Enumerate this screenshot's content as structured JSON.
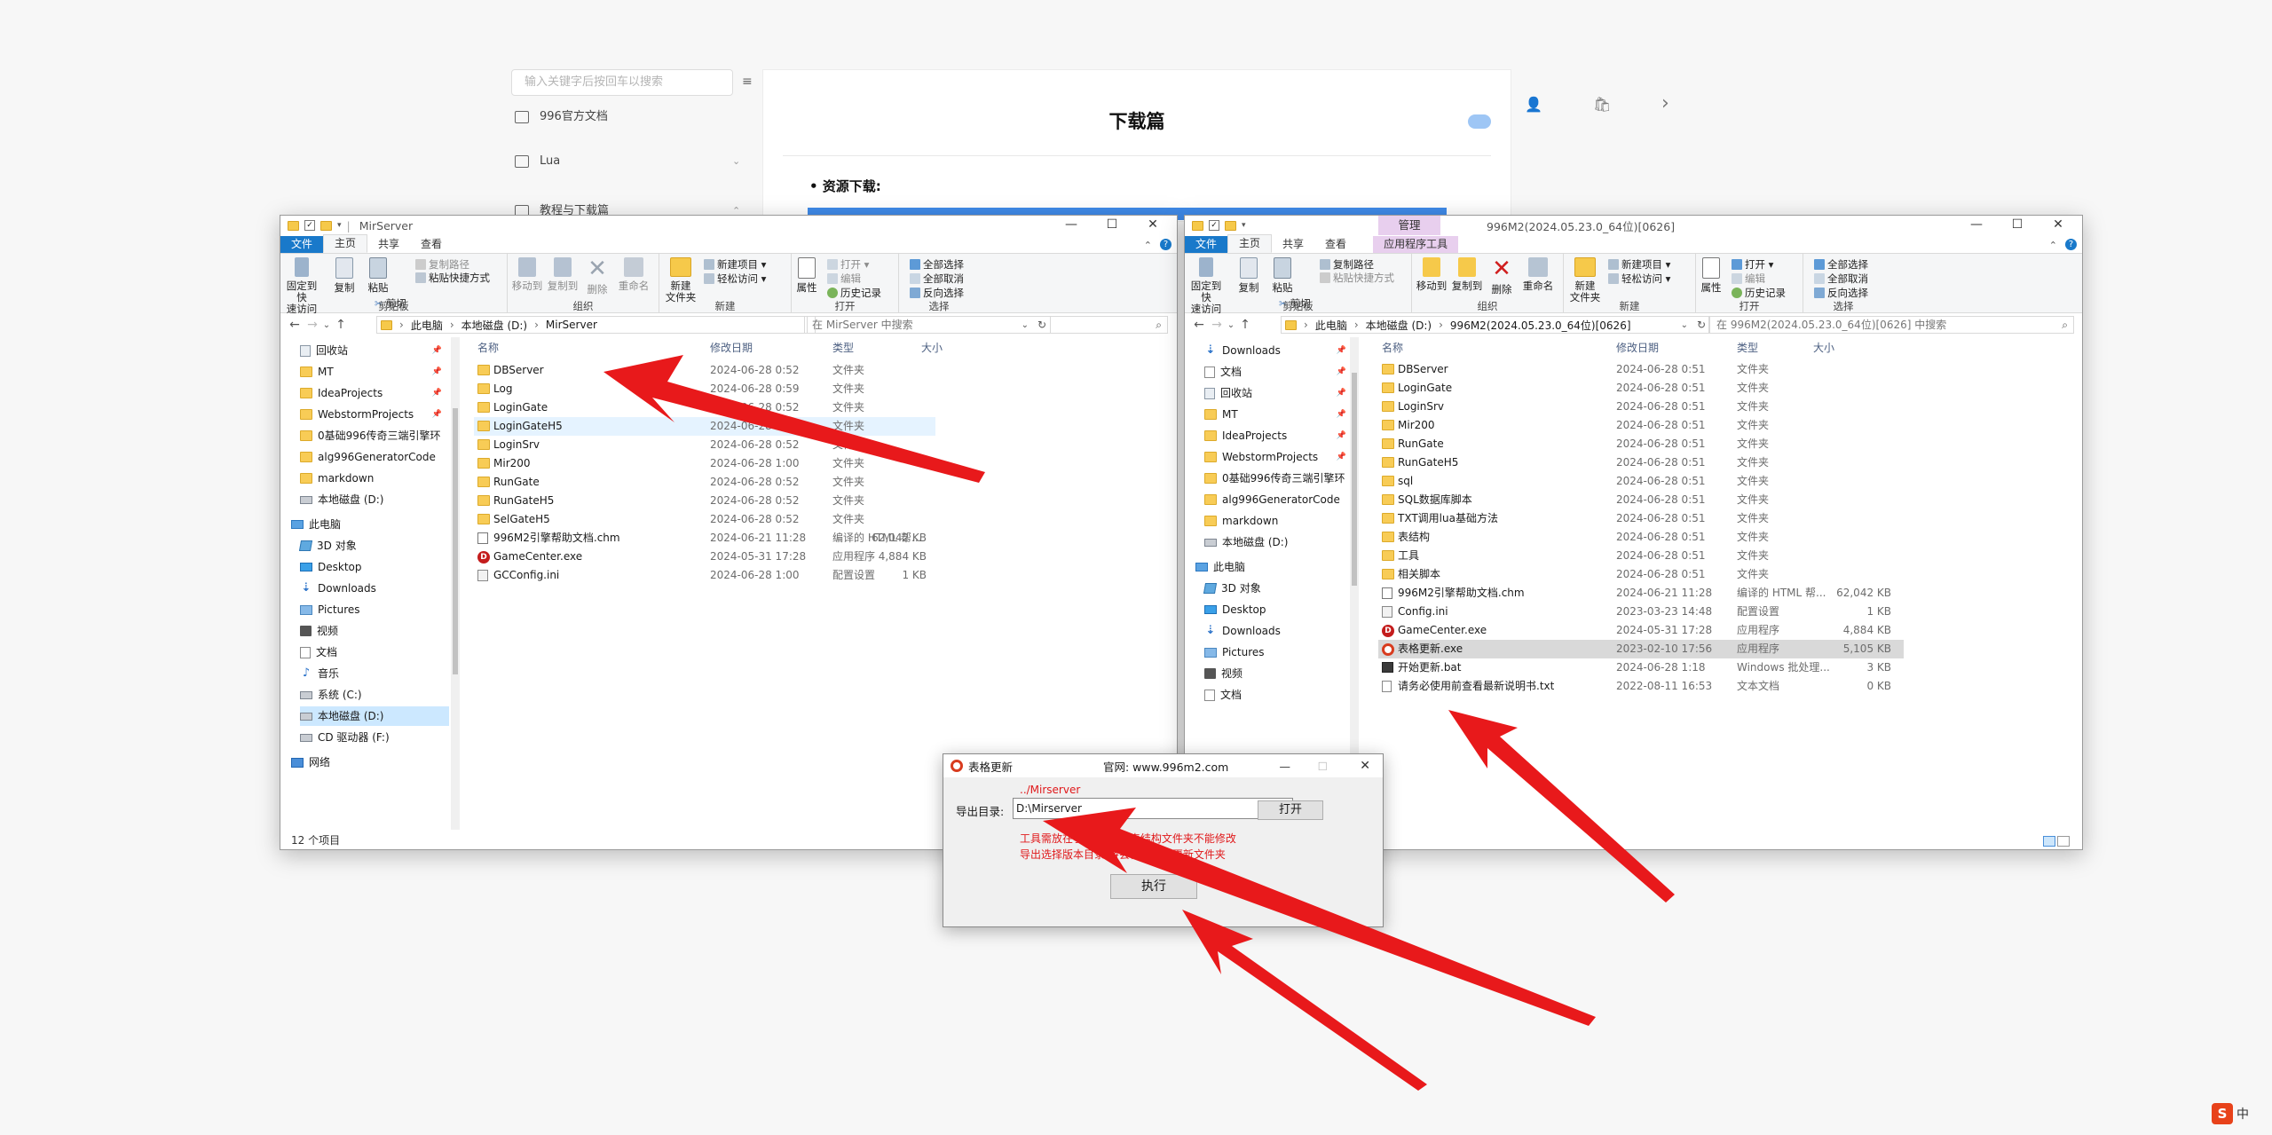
{
  "doc_page": {
    "search_placeholder": "输入关键字后按回车以搜索",
    "menu_icon": "≡",
    "side_items": [
      {
        "label": "996官方文档",
        "icon": "doc-icon"
      },
      {
        "label": "Lua",
        "icon": "folder-icon",
        "chevron": "⌄"
      },
      {
        "label": "教程与下载篇",
        "icon": "folder-icon",
        "chevron": "⌃"
      }
    ],
    "title": "下载篇",
    "subtitle": "• 资源下载:",
    "top_icons": {
      "user": "👤",
      "bag": "🛍",
      "next": "›"
    }
  },
  "left_window": {
    "title": "MirServer",
    "controls": {
      "min": "—",
      "max": "☐",
      "close": "✕"
    },
    "tabs": [
      "文件",
      "主页",
      "共享",
      "查看"
    ],
    "ribbon": {
      "pin": "固定到快\n速访问",
      "copy": "复制",
      "paste": "粘贴",
      "copy_path": "复制路径",
      "paste_shortcut": "粘贴快捷方式",
      "cut": "剪切",
      "clipboard": "剪贴板",
      "move_to": "移动到",
      "copy_to": "复制到",
      "delete": "删除",
      "rename": "重命名",
      "organize": "组织",
      "new_folder": "新建\n文件夹",
      "new_item": "新建项目 ▾",
      "easy_access": "轻松访问 ▾",
      "new": "新建",
      "properties": "属性",
      "open": "打开 ▾",
      "edit": "编辑",
      "history": "历史记录",
      "open_group": "打开",
      "select_all": "全部选择",
      "select_none": "全部取消",
      "invert": "反向选择",
      "select_group": "选择"
    },
    "breadcrumb": [
      "此电脑",
      "本地磁盘 (D:)",
      "MirServer"
    ],
    "search_placeholder": "在 MirServer 中搜索",
    "nav": [
      {
        "label": "回收站",
        "icon": "recycle",
        "pinned": true
      },
      {
        "label": "MT",
        "icon": "folder",
        "pinned": true
      },
      {
        "label": "IdeaProjects",
        "icon": "folder",
        "pinned": true
      },
      {
        "label": "WebstormProjects",
        "icon": "folder",
        "pinned": true
      },
      {
        "label": "0基础996传奇三端引擎环",
        "icon": "folder"
      },
      {
        "label": "alg996GeneratorCode",
        "icon": "folder"
      },
      {
        "label": "markdown",
        "icon": "folder"
      },
      {
        "label": "本地磁盘 (D:)",
        "icon": "drive"
      },
      {
        "label": "此电脑",
        "icon": "pc"
      },
      {
        "label": "3D 对象",
        "icon": "obj3d"
      },
      {
        "label": "Desktop",
        "icon": "desk"
      },
      {
        "label": "Downloads",
        "icon": "down"
      },
      {
        "label": "Pictures",
        "icon": "pics"
      },
      {
        "label": "视频",
        "icon": "video"
      },
      {
        "label": "文档",
        "icon": "doc"
      },
      {
        "label": "音乐",
        "icon": "music"
      },
      {
        "label": "系统 (C:)",
        "icon": "drive"
      },
      {
        "label": "本地磁盘 (D:)",
        "icon": "drive",
        "selected": true
      },
      {
        "label": "CD 驱动器 (F:)",
        "icon": "drive"
      },
      {
        "label": "网络",
        "icon": "net"
      }
    ],
    "columns": [
      "名称",
      "修改日期",
      "类型",
      "大小"
    ],
    "files": [
      {
        "name": "DBServer",
        "date": "2024-06-28 0:52",
        "type": "文件夹",
        "size": "",
        "icon": "folder"
      },
      {
        "name": "Log",
        "date": "2024-06-28 0:59",
        "type": "文件夹",
        "size": "",
        "icon": "folder"
      },
      {
        "name": "LoginGate",
        "date": "2024-06-28 0:52",
        "type": "文件夹",
        "size": "",
        "icon": "folder"
      },
      {
        "name": "LoginGateH5",
        "date": "2024-06-28 0:52",
        "type": "文件夹",
        "size": "",
        "icon": "folder",
        "hover": true
      },
      {
        "name": "LoginSrv",
        "date": "2024-06-28 0:52",
        "type": "文件夹",
        "size": "",
        "icon": "folder"
      },
      {
        "name": "Mir200",
        "date": "2024-06-28 1:00",
        "type": "文件夹",
        "size": "",
        "icon": "folder"
      },
      {
        "name": "RunGate",
        "date": "2024-06-28 0:52",
        "type": "文件夹",
        "size": "",
        "icon": "folder"
      },
      {
        "name": "RunGateH5",
        "date": "2024-06-28 0:52",
        "type": "文件夹",
        "size": "",
        "icon": "folder"
      },
      {
        "name": "SelGateH5",
        "date": "2024-06-28 0:52",
        "type": "文件夹",
        "size": "",
        "icon": "folder"
      },
      {
        "name": "996M2引擎帮助文档.chm",
        "date": "2024-06-21 11:28",
        "type": "编译的 HTML 帮...",
        "size": "62,042 KB",
        "icon": "chm"
      },
      {
        "name": "GameCenter.exe",
        "date": "2024-05-31 17:28",
        "type": "应用程序",
        "size": "4,884 KB",
        "icon": "exe-d"
      },
      {
        "name": "GCConfig.ini",
        "date": "2024-06-28 1:00",
        "type": "配置设置",
        "size": "1 KB",
        "icon": "ini"
      }
    ],
    "status": "12 个项目"
  },
  "right_window": {
    "title": "996M2(2024.05.23.0_64位)[0626]",
    "manage_tab": "管理",
    "controls": {
      "min": "—",
      "max": "☐",
      "close": "✕"
    },
    "tabs": [
      "文件",
      "主页",
      "共享",
      "查看",
      "应用程序工具"
    ],
    "breadcrumb": [
      "此电脑",
      "本地磁盘 (D:)",
      "996M2(2024.05.23.0_64位)[0626]"
    ],
    "search_placeholder": "在 996M2(2024.05.23.0_64位)[0626] 中搜索",
    "nav": [
      {
        "label": "Downloads",
        "icon": "down",
        "pinned": true
      },
      {
        "label": "文档",
        "icon": "doc",
        "pinned": true
      },
      {
        "label": "回收站",
        "icon": "recycle",
        "pinned": true
      },
      {
        "label": "MT",
        "icon": "folder",
        "pinned": true
      },
      {
        "label": "IdeaProjects",
        "icon": "folder",
        "pinned": true
      },
      {
        "label": "WebstormProjects",
        "icon": "folder",
        "pinned": true
      },
      {
        "label": "0基础996传奇三端引擎环",
        "icon": "folder"
      },
      {
        "label": "alg996GeneratorCode",
        "icon": "folder"
      },
      {
        "label": "markdown",
        "icon": "folder"
      },
      {
        "label": "本地磁盘 (D:)",
        "icon": "drive"
      },
      {
        "label": "此电脑",
        "icon": "pc"
      },
      {
        "label": "3D 对象",
        "icon": "obj3d"
      },
      {
        "label": "Desktop",
        "icon": "desk"
      },
      {
        "label": "Downloads",
        "icon": "down"
      },
      {
        "label": "Pictures",
        "icon": "pics"
      },
      {
        "label": "视频",
        "icon": "video"
      },
      {
        "label": "文档",
        "icon": "doc"
      }
    ],
    "columns": [
      "名称",
      "修改日期",
      "类型",
      "大小"
    ],
    "files": [
      {
        "name": "DBServer",
        "date": "2024-06-28 0:51",
        "type": "文件夹",
        "size": "",
        "icon": "folder"
      },
      {
        "name": "LoginGate",
        "date": "2024-06-28 0:51",
        "type": "文件夹",
        "size": "",
        "icon": "folder"
      },
      {
        "name": "LoginSrv",
        "date": "2024-06-28 0:51",
        "type": "文件夹",
        "size": "",
        "icon": "folder"
      },
      {
        "name": "Mir200",
        "date": "2024-06-28 0:51",
        "type": "文件夹",
        "size": "",
        "icon": "folder"
      },
      {
        "name": "RunGate",
        "date": "2024-06-28 0:51",
        "type": "文件夹",
        "size": "",
        "icon": "folder"
      },
      {
        "name": "RunGateH5",
        "date": "2024-06-28 0:51",
        "type": "文件夹",
        "size": "",
        "icon": "folder"
      },
      {
        "name": "sql",
        "date": "2024-06-28 0:51",
        "type": "文件夹",
        "size": "",
        "icon": "folder"
      },
      {
        "name": "SQL数据库脚本",
        "date": "2024-06-28 0:51",
        "type": "文件夹",
        "size": "",
        "icon": "folder"
      },
      {
        "name": "TXT调用lua基础方法",
        "date": "2024-06-28 0:51",
        "type": "文件夹",
        "size": "",
        "icon": "folder"
      },
      {
        "name": "表结构",
        "date": "2024-06-28 0:51",
        "type": "文件夹",
        "size": "",
        "icon": "folder"
      },
      {
        "name": "工具",
        "date": "2024-06-28 0:51",
        "type": "文件夹",
        "size": "",
        "icon": "folder"
      },
      {
        "name": "相关脚本",
        "date": "2024-06-28 0:51",
        "type": "文件夹",
        "size": "",
        "icon": "folder"
      },
      {
        "name": "996M2引擎帮助文档.chm",
        "date": "2024-06-21 11:28",
        "type": "编译的 HTML 帮...",
        "size": "62,042 KB",
        "icon": "chm"
      },
      {
        "name": "Config.ini",
        "date": "2023-03-23 14:48",
        "type": "配置设置",
        "size": "1 KB",
        "icon": "ini"
      },
      {
        "name": "GameCenter.exe",
        "date": "2024-05-31 17:28",
        "type": "应用程序",
        "size": "4,884 KB",
        "icon": "exe-d"
      },
      {
        "name": "表格更新.exe",
        "date": "2023-02-10 17:56",
        "type": "应用程序",
        "size": "5,105 KB",
        "icon": "exe-r",
        "selected": true
      },
      {
        "name": "开始更新.bat",
        "date": "2024-06-28 1:18",
        "type": "Windows 批处理...",
        "size": "3 KB",
        "icon": "bat"
      },
      {
        "name": "请务必使用前查看最新说明书.txt",
        "date": "2022-08-11 16:53",
        "type": "文本文档",
        "size": "0 KB",
        "icon": "txt"
      }
    ]
  },
  "dialog": {
    "title": "表格更新",
    "website": "官网: www.996m2.com",
    "controls": {
      "min": "—",
      "max": "☐",
      "close": "✕"
    },
    "hint_top": "../Mirserver",
    "export_label": "导出目录:",
    "export_value": "D:\\Mirserver",
    "open_button": "打开",
    "note_line1": "工具需放在引擎目录下 表结构文件夹不能修改",
    "note_line2": "导出选择版本目录 将会覆盖新版更新文件夹",
    "run_button": "执行"
  },
  "ime": {
    "logo": "S",
    "lang": "中"
  },
  "colors": {
    "arrow": "#e8191b",
    "ribbon_file_tab": "#1979ca",
    "selection": "#cce8ff",
    "dialog_note": "#e0181a"
  }
}
